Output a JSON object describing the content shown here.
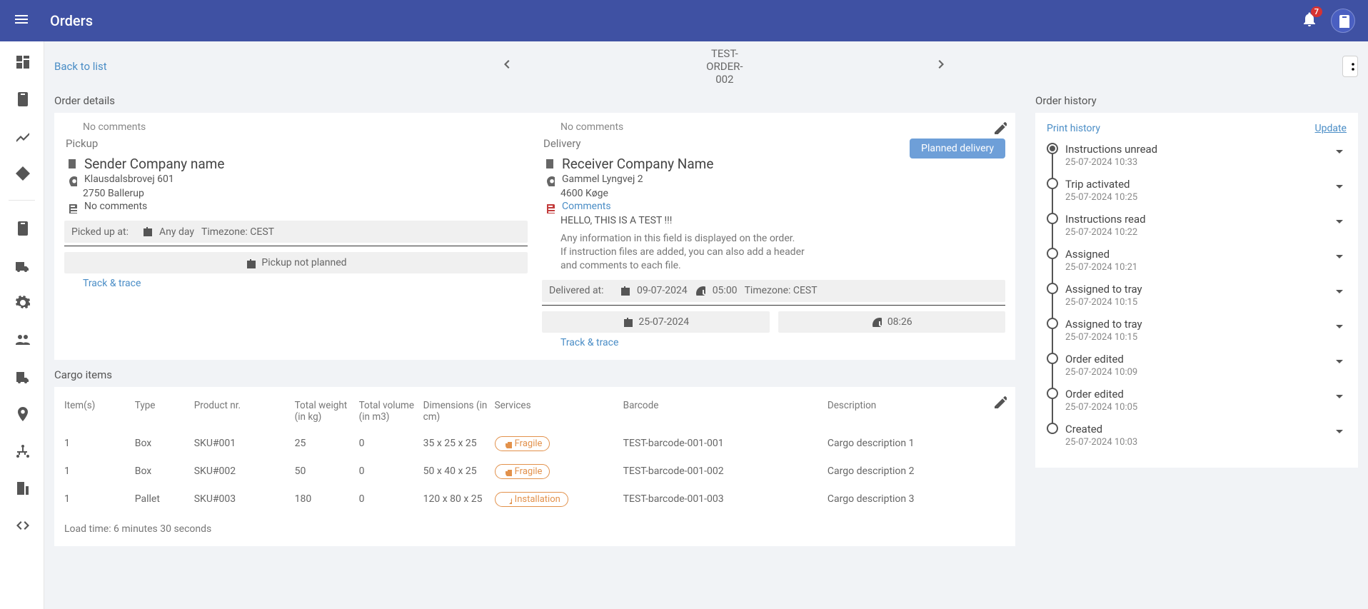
{
  "topbar": {
    "title": "Orders",
    "notif_count": "7"
  },
  "subheader": {
    "back": "Back to list",
    "order_id": "TEST-ORDER-002"
  },
  "details": {
    "title": "Order details",
    "pickup": {
      "no_comments": "No comments",
      "label": "Pickup",
      "company": "Sender Company name",
      "addr1": "Klausdalsbrovej 601",
      "addr2": "2750 Ballerup",
      "note_label": "No comments",
      "picked_at_lbl": "Picked up at:",
      "picked_day": "Any day",
      "picked_tz": "Timezone: CEST",
      "not_planned": "Pickup not planned",
      "track": "Track & trace"
    },
    "delivery": {
      "no_comments": "No comments",
      "label": "Delivery",
      "badge": "Planned delivery",
      "company": "Receiver Company Name",
      "addr1": "Gammel Lyngvej 2",
      "addr2": "4600 Køge",
      "comments_link": "Comments",
      "comments_text": "HELLO, THIS IS A TEST !!!",
      "info1": "Any information in this field is displayed on the order.",
      "info2": "If instruction files are added, you can also add a header",
      "info3": "and comments to each file.",
      "delivered_lbl": "Delivered at:",
      "delivered_date": "09-07-2024",
      "delivered_time": "05:00",
      "delivered_tz": "Timezone: CEST",
      "planned_date": "25-07-2024",
      "planned_time": "08:26",
      "track": "Track & trace"
    }
  },
  "cargo": {
    "title": "Cargo items",
    "headers": {
      "items": "Item(s)",
      "type": "Type",
      "product": "Product nr.",
      "weight": "Total weight (in kg)",
      "volume": "Total volume (in m3)",
      "dims": "Dimensions (in cm)",
      "services": "Services",
      "barcode": "Barcode",
      "desc": "Description"
    },
    "rows": [
      {
        "items": "1",
        "type": "Box",
        "product": "SKU#001",
        "weight": "25",
        "volume": "0",
        "dims": "35 x 25 x 25",
        "service": "Fragile",
        "svc_icon": "trophy",
        "barcode": "TEST-barcode-001-001",
        "desc": "Cargo description 1"
      },
      {
        "items": "1",
        "type": "Box",
        "product": "SKU#002",
        "weight": "50",
        "volume": "0",
        "dims": "50 x 40 x 25",
        "service": "Fragile",
        "svc_icon": "trophy",
        "barcode": "TEST-barcode-001-002",
        "desc": "Cargo description 2"
      },
      {
        "items": "1",
        "type": "Pallet",
        "product": "SKU#003",
        "weight": "180",
        "volume": "0",
        "dims": "120 x 80 x 25",
        "service": "Installation",
        "svc_icon": "wrench",
        "barcode": "TEST-barcode-001-003",
        "desc": "Cargo description 3"
      }
    ],
    "load_time": "Load time: 6 minutes 30 seconds"
  },
  "history": {
    "title": "Order history",
    "print": "Print history",
    "update": "Update",
    "items": [
      {
        "title": "Instructions unread",
        "date": "25-07-2024 10:33",
        "current": true
      },
      {
        "title": "Trip activated",
        "date": "25-07-2024 10:25"
      },
      {
        "title": "Instructions read",
        "date": "25-07-2024 10:22"
      },
      {
        "title": "Assigned",
        "date": "25-07-2024 10:21"
      },
      {
        "title": "Assigned to tray",
        "date": "25-07-2024 10:15"
      },
      {
        "title": "Assigned to tray",
        "date": "25-07-2024 10:15"
      },
      {
        "title": "Order edited",
        "date": "25-07-2024 10:09"
      },
      {
        "title": "Order edited",
        "date": "25-07-2024 10:05"
      },
      {
        "title": "Created",
        "date": "25-07-2024 10:03"
      }
    ]
  }
}
